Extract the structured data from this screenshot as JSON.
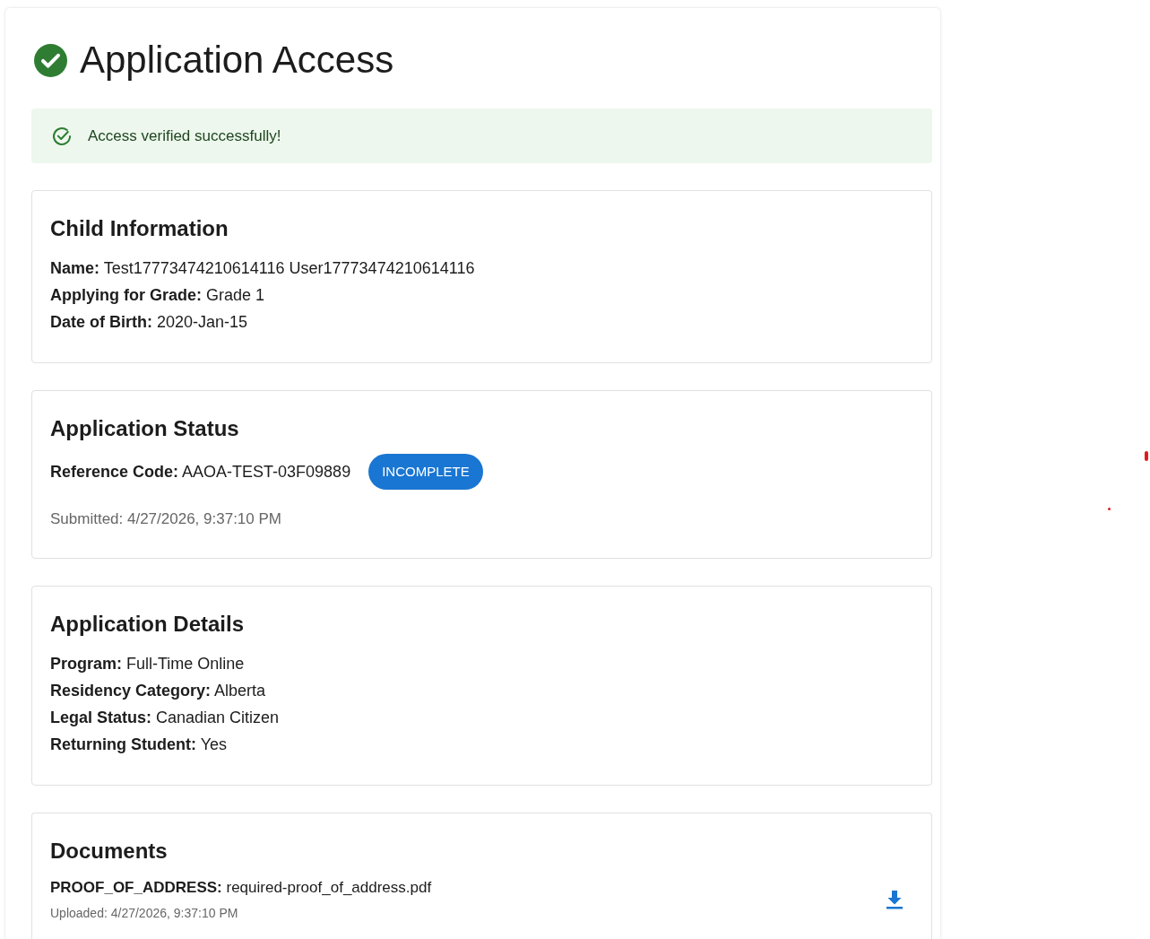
{
  "page": {
    "title": "Application Access"
  },
  "alert": {
    "message": "Access verified successfully!"
  },
  "sections": [
    {
      "kind": "fields",
      "heading": "Child Information",
      "fields": [
        {
          "label": "Name:",
          "value": "Test17773474210614116 User17773474210614116"
        },
        {
          "label": "Applying for Grade:",
          "value": "Grade 1"
        },
        {
          "label": "Date of Birth:",
          "value": "2020-Jan-15"
        }
      ]
    },
    {
      "kind": "status",
      "heading": "Application Status",
      "reference": {
        "label": "Reference Code:",
        "value": "AAOA-TEST-03F09889"
      },
      "status": "INCOMPLETE",
      "submitted": "Submitted: 4/27/2026, 9:37:10 PM"
    },
    {
      "kind": "fields",
      "heading": "Application Details",
      "fields": [
        {
          "label": "Program:",
          "value": "Full-Time Online"
        },
        {
          "label": "Residency Category:",
          "value": "Alberta"
        },
        {
          "label": "Legal Status:",
          "value": "Canadian Citizen"
        },
        {
          "label": "Returning Student:",
          "value": "Yes"
        }
      ]
    },
    {
      "kind": "documents",
      "heading": "Documents",
      "documents": [
        {
          "label": "PROOF_OF_ADDRESS:",
          "file": "required-proof_of_address.pdf",
          "uploaded": "Uploaded: 4/27/2026, 9:37:10 PM"
        }
      ]
    }
  ]
}
